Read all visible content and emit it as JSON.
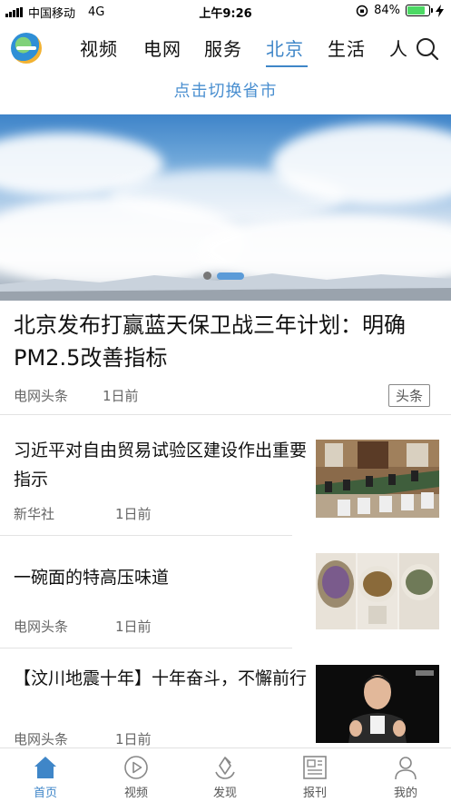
{
  "status": {
    "carrier": "中国移动",
    "network": "4G",
    "time": "上午9:26",
    "battery": "84%"
  },
  "nav": {
    "tabs": [
      {
        "label": "视频"
      },
      {
        "label": "电网"
      },
      {
        "label": "服务"
      },
      {
        "label": "北京",
        "active": true
      },
      {
        "label": "生活"
      },
      {
        "label": "人"
      }
    ],
    "switch_city": "点击切换省市"
  },
  "banner": {
    "slides_total": 2,
    "current_slide": 2
  },
  "featured": {
    "title": "北京发布打赢蓝天保卫战三年计划：明确PM2.5改善指标",
    "source": "电网头条",
    "time": "1日前",
    "tag": "头条"
  },
  "news": [
    {
      "title": "习近平对自由贸易试验区建设作出重要指示",
      "source": "新华社",
      "time": "1日前"
    },
    {
      "title": "一碗面的特高压味道",
      "source": "电网头条",
      "time": "1日前"
    },
    {
      "title": "【汶川地震十年】十年奋斗，不懈前行",
      "source": "电网头条",
      "time": "1日前"
    }
  ],
  "bottom_nav": [
    {
      "label": "首页",
      "icon": "home-icon",
      "active": true
    },
    {
      "label": "视频",
      "icon": "play-icon"
    },
    {
      "label": "发现",
      "icon": "discover-icon"
    },
    {
      "label": "报刊",
      "icon": "newspaper-icon"
    },
    {
      "label": "我的",
      "icon": "user-icon"
    }
  ],
  "colors": {
    "accent": "#3f86c8",
    "battery": "#4cd964"
  }
}
